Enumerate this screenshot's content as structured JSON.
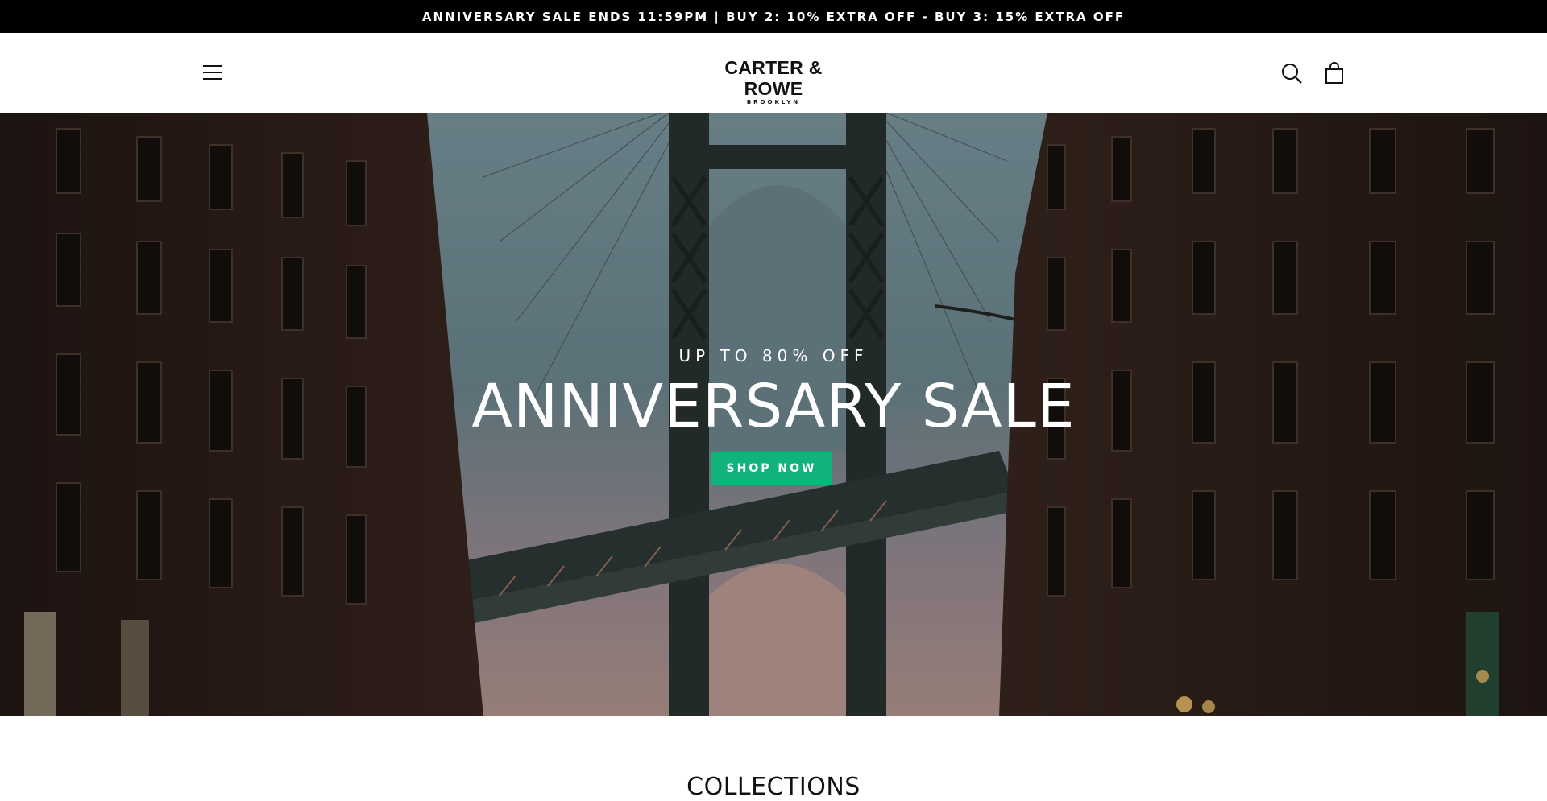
{
  "announcement": {
    "text": "ANNIVERSARY SALE ENDS 11:59PM | BUY 2: 10% EXTRA OFF - BUY 3: 15% EXTRA OFF"
  },
  "header": {
    "logo_main": "CARTER & ROWE",
    "logo_sub": "BROOKLYN",
    "icons": [
      "menu-icon",
      "search-icon",
      "cart-icon"
    ]
  },
  "hero": {
    "kicker": "UP TO 80% OFF",
    "title": "ANNIVERSARY SALE",
    "cta_label": "SHOP NOW",
    "cta_color": "#10b37a"
  },
  "collections": {
    "heading": "COLLECTIONS"
  }
}
